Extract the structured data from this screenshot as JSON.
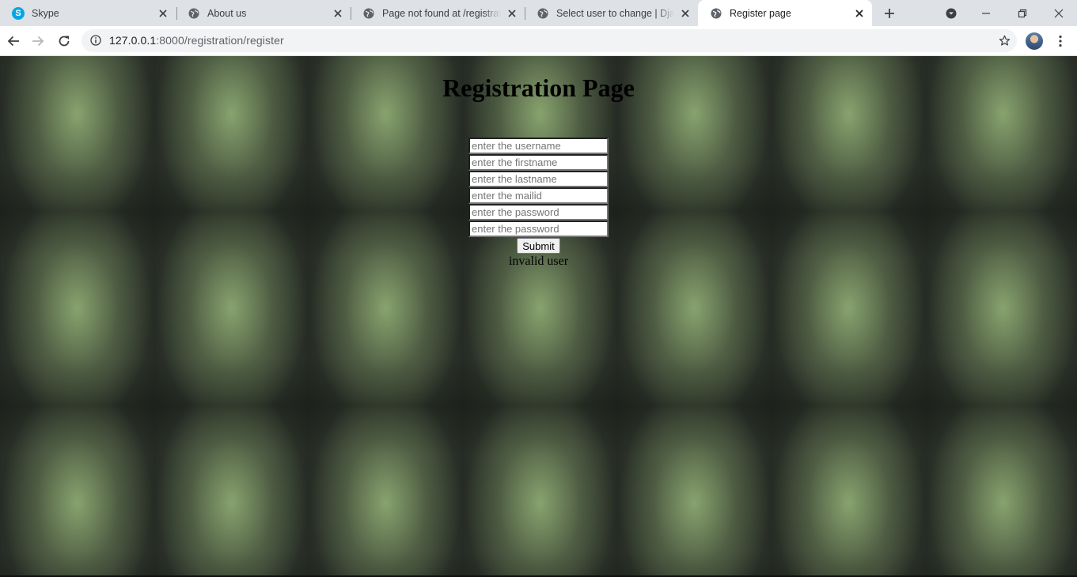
{
  "browser": {
    "tabs": [
      {
        "title": "Skype",
        "favicon": "skype-icon",
        "active": false
      },
      {
        "title": "About us",
        "favicon": "globe-icon",
        "active": false
      },
      {
        "title": "Page not found at /registration",
        "favicon": "globe-icon",
        "active": false
      },
      {
        "title": "Select user to change | Django",
        "favicon": "globe-icon",
        "active": false
      },
      {
        "title": "Register page",
        "favicon": "globe-icon",
        "active": true
      }
    ],
    "url_host": "127.0.0.1",
    "url_rest": ":8000/registration/register"
  },
  "page": {
    "title": "Registration Page",
    "fields": [
      {
        "placeholder": "enter the username",
        "value": ""
      },
      {
        "placeholder": "enter the firstname",
        "value": ""
      },
      {
        "placeholder": "enter the lastname",
        "value": ""
      },
      {
        "placeholder": "enter the mailid",
        "value": ""
      },
      {
        "placeholder": "enter the password",
        "value": ""
      },
      {
        "placeholder": "enter the password",
        "value": ""
      }
    ],
    "submit_label": "Submit",
    "message": "invalid user"
  },
  "colors": {
    "tabstrip": "#dee1e6",
    "active_tab": "#ffffff",
    "skype_blue": "#00a8e6",
    "page_background": "#3a4136"
  }
}
